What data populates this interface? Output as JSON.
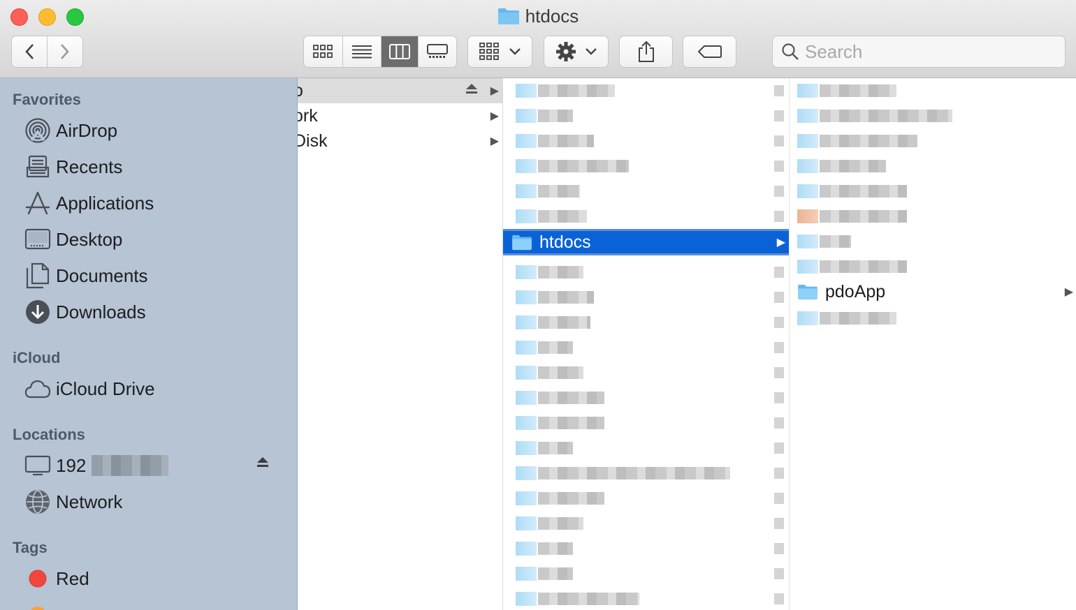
{
  "window": {
    "title": "htdocs"
  },
  "toolbar": {
    "back_icon": "chevron-left-icon",
    "forward_icon": "chevron-right-icon",
    "view_modes": [
      "icon-view",
      "list-view",
      "column-view",
      "gallery-view"
    ],
    "active_view": "column-view",
    "search_placeholder": "Search"
  },
  "sidebar": {
    "favorites_header": "Favorites",
    "favorites": [
      {
        "label": "AirDrop",
        "icon": "airdrop-icon"
      },
      {
        "label": "Recents",
        "icon": "recents-icon"
      },
      {
        "label": "Applications",
        "icon": "applications-icon"
      },
      {
        "label": "Desktop",
        "icon": "desktop-icon"
      },
      {
        "label": "Documents",
        "icon": "documents-icon"
      },
      {
        "label": "Downloads",
        "icon": "downloads-icon"
      }
    ],
    "icloud_header": "iCloud",
    "icloud": [
      {
        "label": "iCloud Drive",
        "icon": "cloud-icon"
      }
    ],
    "locations_header": "Locations",
    "locations": [
      {
        "label": "192",
        "icon": "monitor-icon"
      },
      {
        "label": "Network",
        "icon": "network-icon"
      }
    ],
    "tags_header": "Tags",
    "tags": [
      {
        "label": "Red",
        "color": "#f1463d"
      }
    ]
  },
  "columns": {
    "col1": [
      "o",
      "ork",
      "Disk"
    ],
    "col2_selected": "htdocs",
    "col3_visible": "pdoApp"
  },
  "colors": {
    "selection": "#0a63d6",
    "sidebar": "#b6c4d4",
    "folder": "#66b8f0"
  }
}
